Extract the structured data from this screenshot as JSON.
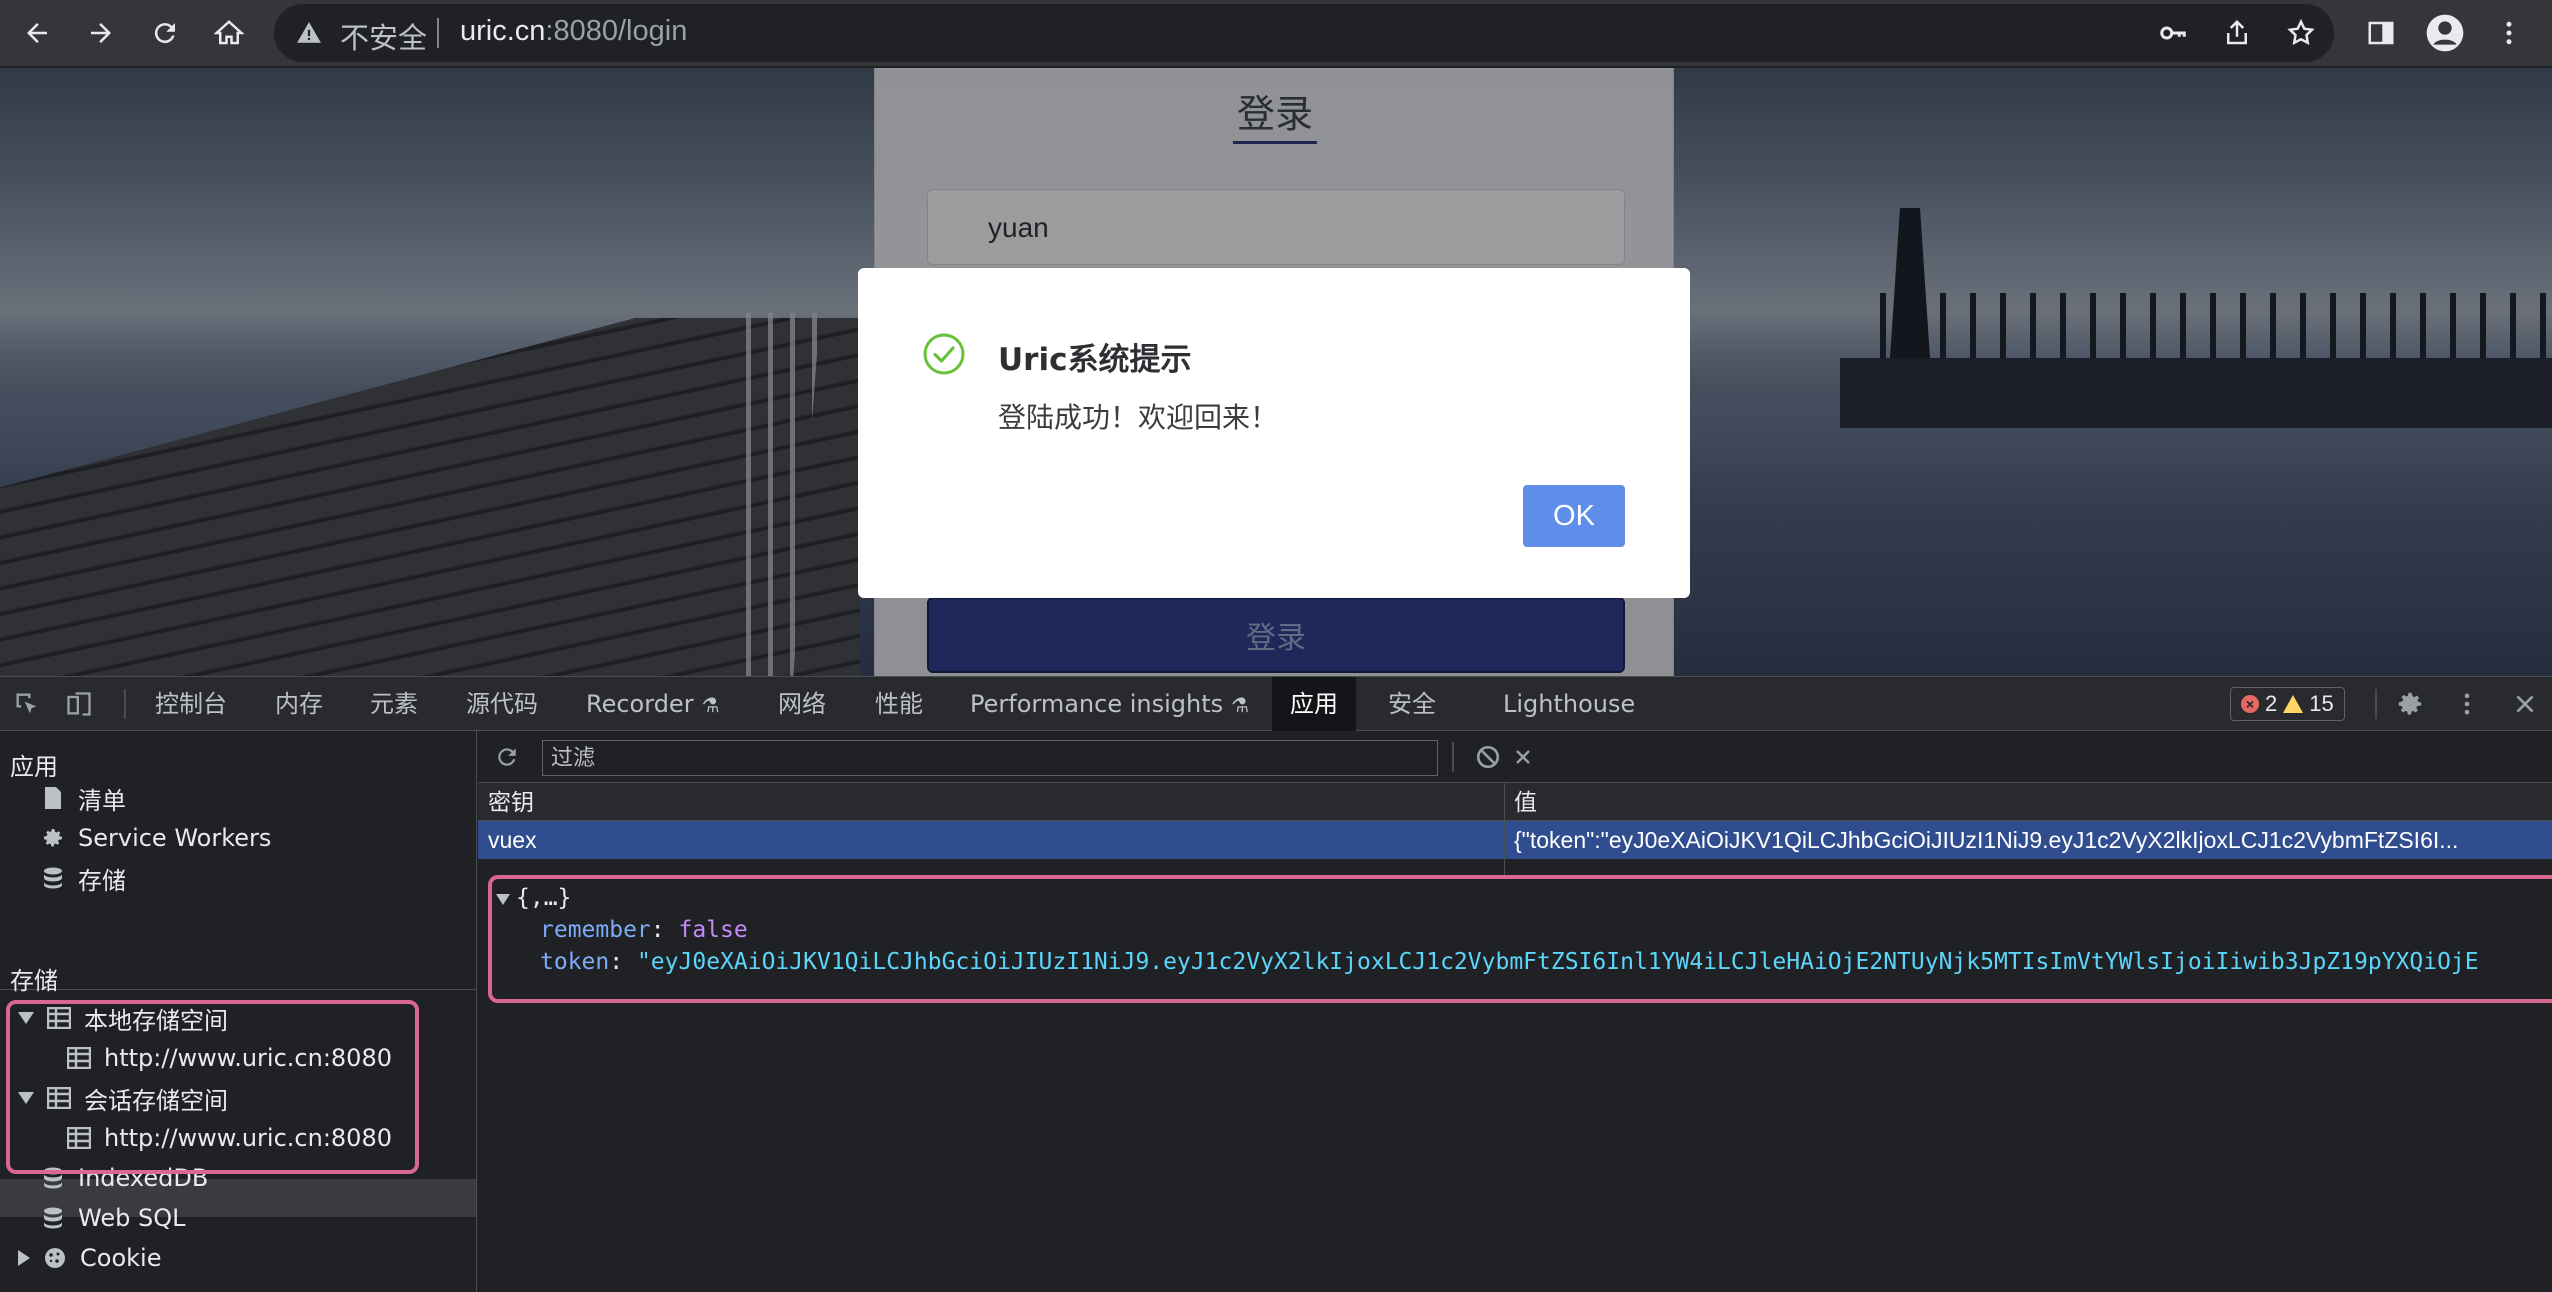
{
  "browser": {
    "security_label": "不安全",
    "url_host": "uric.cn",
    "url_rest": ":8080/login"
  },
  "page": {
    "login_title": "登录",
    "username_value": "yuan",
    "login_button": "登录"
  },
  "dialog": {
    "title": "Uric系统提示",
    "message": "登陆成功！欢迎回来！",
    "ok_label": "OK",
    "success_color": "#67c23a"
  },
  "devtools": {
    "tabs": [
      "控制台",
      "内存",
      "元素",
      "源代码",
      "Recorder",
      "网络",
      "性能",
      "Performance insights",
      "应用",
      "安全",
      "Lighthouse"
    ],
    "active_tab": "应用",
    "error_count": "2",
    "warning_count": "15",
    "sidebar": {
      "app_heading": "应用",
      "app_items": [
        "清单",
        "Service Workers",
        "存储"
      ],
      "storage_heading": "存储",
      "local_storage": "本地存储空间",
      "local_storage_origin": "http://www.uric.cn:8080",
      "session_storage": "会话存储空间",
      "session_storage_origin": "http://www.uric.cn:8080",
      "indexeddb": "IndexedDB",
      "websql": "Web SQL",
      "cookie": "Cookie"
    },
    "filter_placeholder": "过滤",
    "grid": {
      "key_header": "密钥",
      "value_header": "值",
      "rows": [
        {
          "key": "vuex",
          "value": "{\"token\":\"eyJ0eXAiOiJKV1QiLCJhbGciOiJIUzI1NiJ9.eyJ1c2VyX2lkIjoxLCJ1c2VybmFtZSI6I..."
        }
      ]
    },
    "preview": {
      "root": "{,…}",
      "remember_key": "remember",
      "remember_value": "false",
      "token_key": "token",
      "token_value": "\"eyJ0eXAiOiJKV1QiLCJhbGciOiJIUzI1NiJ9.eyJ1c2VyX2lkIjoxLCJ1c2VybmFtZSI6Inl1YW4iLCJleHAiOjE2NTUyNjk5MTIsImVtYWlsIjoiIiwib3JpZ19pYXQiOjE"
    }
  }
}
